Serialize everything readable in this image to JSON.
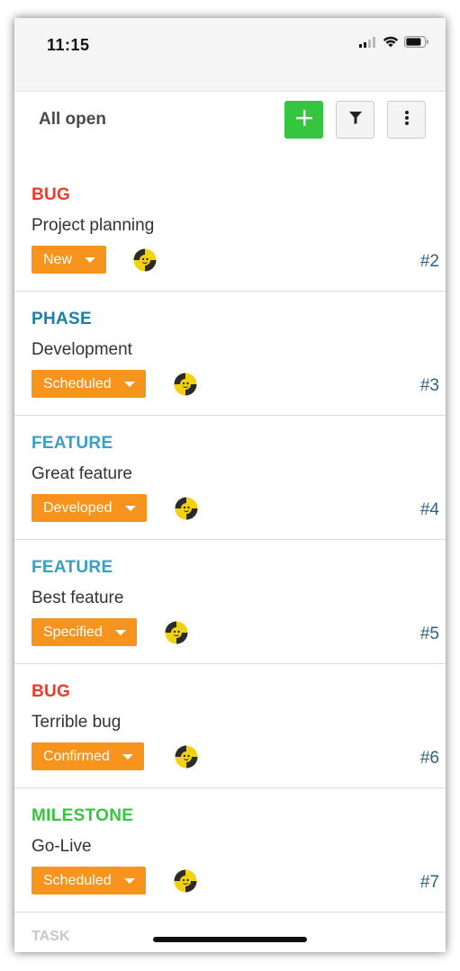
{
  "status_bar": {
    "time": "11:15",
    "icons": [
      "cellular-signal-icon",
      "wifi-icon",
      "battery-icon"
    ]
  },
  "toolbar": {
    "title": "All open",
    "add_icon": "plus-icon",
    "filter_icon": "filter-icon",
    "more_icon": "more-vertical-icon",
    "add_color": "#35c53f"
  },
  "colors": {
    "bug": "#ee3b2a",
    "phase": "#1c7fa6",
    "feature": "#3a9fc0",
    "milestone": "#35c53f",
    "status": "#f7941d",
    "id": "#2e6183"
  },
  "work_packages": [
    {
      "type": "BUG",
      "type_color": "#ee3b2a",
      "subject": "Project planning",
      "status": "New",
      "id": "#2",
      "avatar_icon": "user-avatar-icon"
    },
    {
      "type": "PHASE",
      "type_color": "#1c7fa6",
      "subject": "Development",
      "status": "Scheduled",
      "id": "#3",
      "avatar_icon": "user-avatar-icon"
    },
    {
      "type": "FEATURE",
      "type_color": "#3a9fc0",
      "subject": "Great feature",
      "status": "Developed",
      "id": "#4",
      "avatar_icon": "user-avatar-icon"
    },
    {
      "type": "FEATURE",
      "type_color": "#3a9fc0",
      "subject": "Best feature",
      "status": "Specified",
      "id": "#5",
      "avatar_icon": "user-avatar-icon"
    },
    {
      "type": "BUG",
      "type_color": "#ee3b2a",
      "subject": "Terrible bug",
      "status": "Confirmed",
      "id": "#6",
      "avatar_icon": "user-avatar-icon"
    },
    {
      "type": "MILESTONE",
      "type_color": "#35c53f",
      "subject": "Go-Live",
      "status": "Scheduled",
      "id": "#7",
      "avatar_icon": "user-avatar-icon"
    }
  ],
  "partial_item": {
    "type": "TASK"
  }
}
